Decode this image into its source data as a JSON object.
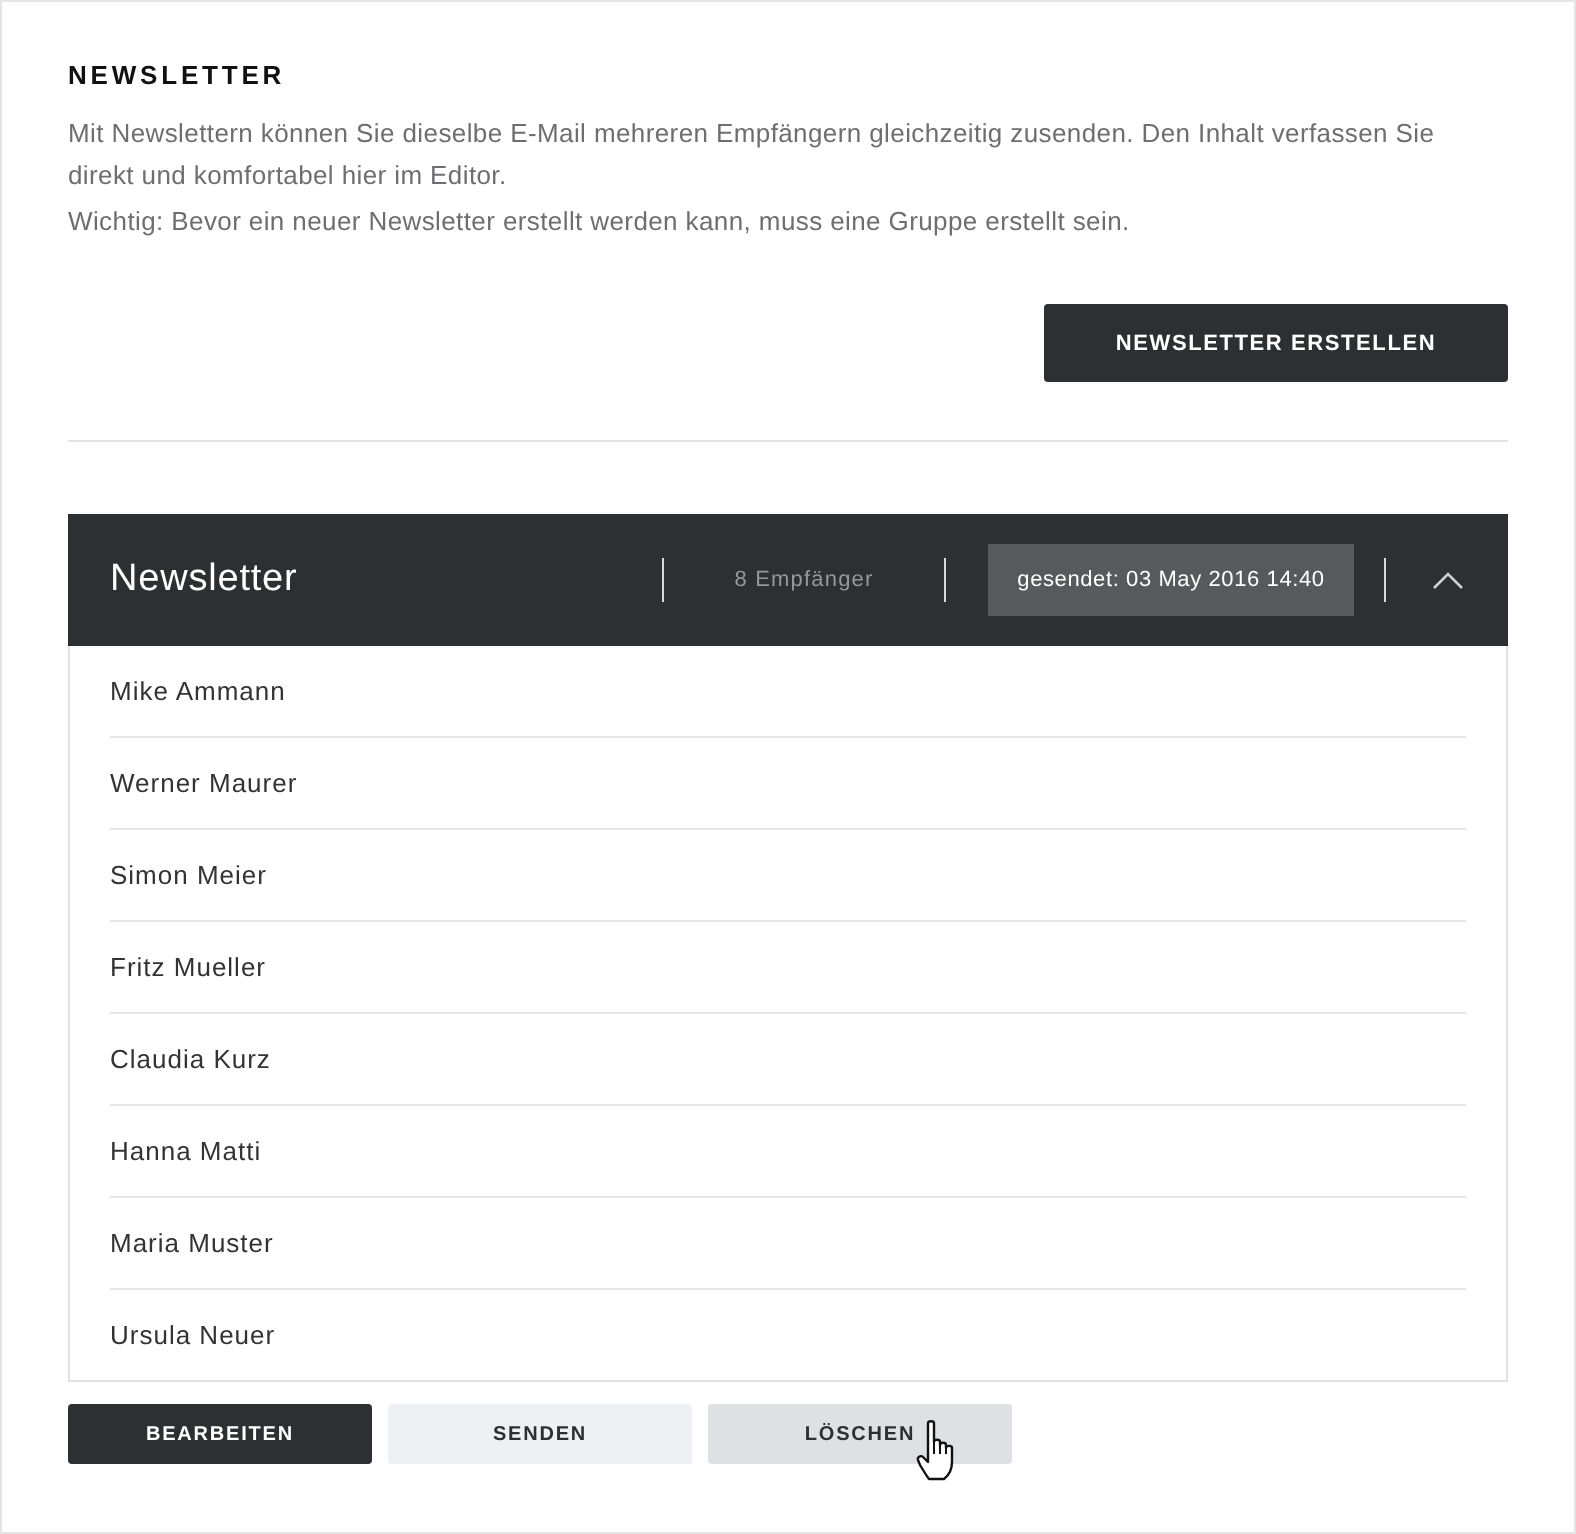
{
  "section": {
    "title": "NEWSLETTER",
    "paragraphs": [
      "Mit Newslettern können Sie dieselbe E-Mail mehreren Empfängern gleichzeitig zusenden. Den Inhalt verfassen Sie direkt und komfortabel hier im Editor.",
      "Wichtig: Bevor ein neuer Newsletter erstellt werden kann, muss eine Gruppe erstellt sein."
    ],
    "create_button": "NEWSLETTER ERSTELLEN"
  },
  "panel": {
    "title": "Newsletter",
    "recipients": "8 Empfänger",
    "sent": "gesendet: 03 May 2016 14:40",
    "expanded": true,
    "rows": [
      "Mike Ammann",
      "Werner Maurer",
      "Simon Meier",
      "Fritz Mueller",
      "Claudia Kurz",
      "Hanna Matti",
      "Maria Muster",
      "Ursula Neuer"
    ]
  },
  "actions": [
    {
      "label": "BEARBEITEN",
      "kind": "primary",
      "hovered": false
    },
    {
      "label": "SENDEN",
      "kind": "secondary",
      "hovered": false
    },
    {
      "label": "LÖSCHEN",
      "kind": "secondary",
      "hovered": true
    }
  ]
}
